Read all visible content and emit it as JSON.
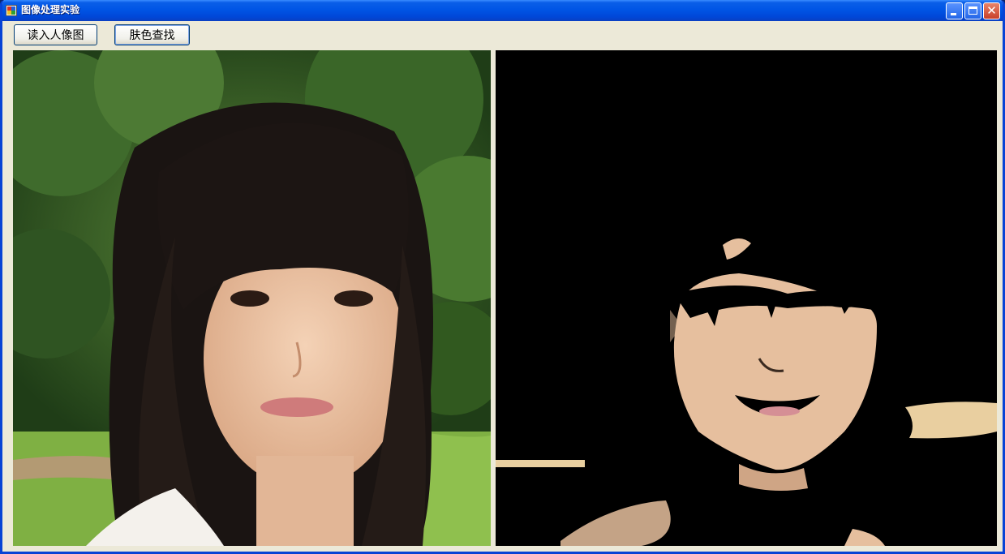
{
  "window": {
    "title": "图像处理实验"
  },
  "toolbar": {
    "load_label": "读入人像图",
    "skin_label": "肤色查找"
  },
  "images": {
    "original": "portrait photo",
    "result": "skin detection result"
  },
  "colors": {
    "titlebar": "#0055e5",
    "window_bg": "#ece9d8",
    "result_bg": "#000000",
    "skin": "#e6bf9e"
  }
}
